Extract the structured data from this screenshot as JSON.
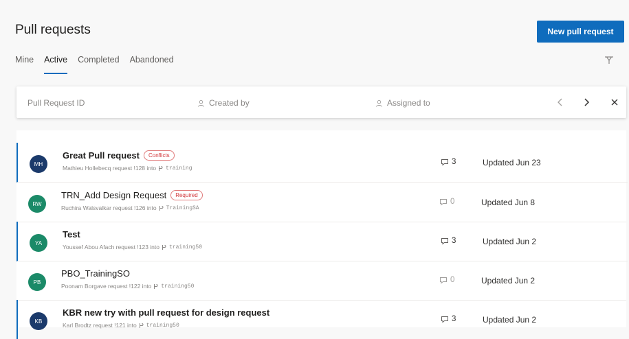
{
  "header": {
    "title": "Pull requests",
    "new_button": "New pull request"
  },
  "tabs": [
    {
      "label": "Mine",
      "active": false
    },
    {
      "label": "Active",
      "active": true
    },
    {
      "label": "Completed",
      "active": false
    },
    {
      "label": "Abandoned",
      "active": false
    }
  ],
  "filters": {
    "pr_id": "Pull Request ID",
    "created_by": "Created by",
    "assigned_to": "Assigned to"
  },
  "colors": {
    "accent": "#0f6cbd",
    "avatar_dark": "#1b3a6b",
    "avatar_green": "#1b8a68"
  },
  "pull_requests": [
    {
      "initials": "MH",
      "avatar_color": "#1b3a6b",
      "title": "Great Pull request",
      "badge": "Conflicts",
      "subtitle": "Mathieu Hollebecq request !128 into",
      "branch": "training",
      "comments": "3",
      "updated": "Updated Jun 23",
      "unread": true
    },
    {
      "initials": "RW",
      "avatar_color": "#1b8a68",
      "title": "TRN_Add Design Request",
      "badge": "Required",
      "subtitle": "Ruchira Walsvalkar request !126 into",
      "branch": "TrainingSA",
      "comments": "0",
      "updated": "Updated Jun 8",
      "unread": false
    },
    {
      "initials": "YA",
      "avatar_color": "#1b8a68",
      "title": "Test",
      "badge": "",
      "subtitle": "Youssef Abou Afach request !123 into",
      "branch": "training50",
      "comments": "3",
      "updated": "Updated Jun 2",
      "unread": true
    },
    {
      "initials": "PB",
      "avatar_color": "#1b8a68",
      "title": "PBO_TrainingSO",
      "badge": "",
      "subtitle": "Poonam Borgave request !122 into",
      "branch": "training50",
      "comments": "0",
      "updated": "Updated Jun 2",
      "unread": false
    },
    {
      "initials": "KB",
      "avatar_color": "#1b3a6b",
      "title": "KBR new try with pull request for design request",
      "badge": "",
      "subtitle": "Karl Brodtz request !121 into",
      "branch": "training50",
      "comments": "3",
      "updated": "Updated Jun 2",
      "unread": true
    }
  ]
}
